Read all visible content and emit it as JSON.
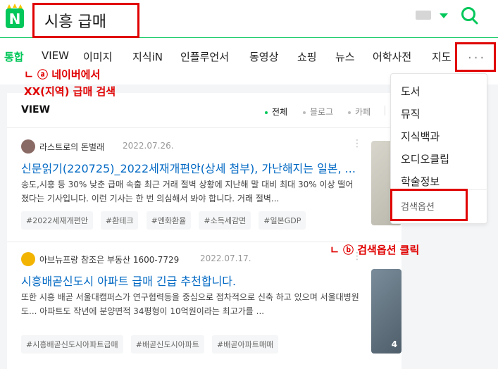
{
  "search": {
    "query": "시흥 급매"
  },
  "header": {
    "logo_letter": "N"
  },
  "tabs": [
    "통합",
    "VIEW",
    "이미지",
    "지식iN",
    "인플루언서",
    "동영상",
    "쇼핑",
    "뉴스",
    "어학사전",
    "지도"
  ],
  "more_label": "···",
  "annotations": {
    "a_line1": "ㄴ ⓐ 네이버에서",
    "a_line2": "XX(지역) 급매 검색",
    "b": "ㄴ ⓑ 검색옵션 클릭"
  },
  "view": {
    "title": "VIEW",
    "filters": [
      "전체",
      "블로그",
      "카페"
    ]
  },
  "posts": [
    {
      "author": "라스트로의 돈벌래",
      "date": "2022.07.26.",
      "title": "신문읽기(220725)_2022세재개편안(상세 첨부), 가난해지는 일본, ...",
      "desc": "송도,시흥 등 30% 낮춘 급매 속출 최근 거래 절벽 상황에 지난해 말 대비 최대 30% 이상 떨어졌다는 기사입니다. 이런 기사는 한 번 의심해서 봐야 합니다. 거래 절벽...",
      "tags": [
        "#2022세재개편안",
        "#환테크",
        "#엔화환율",
        "#소득세감면",
        "#일본GDP"
      ]
    },
    {
      "author": "아브뉴프랑 참조은 부동산 1600-7729",
      "date": "2022.07.17.",
      "title": "시흥배곧신도시 아파트 급매 긴급 추천합니다.",
      "desc": "또한 시흥 배곧 서울대캠퍼스가 연구협력동을 중심으로 점차적으로 신축 하고 있으며 서울대병원도... 아파트도 작년에 분양면적 34평형이 10억원이라는 최고가를 ...",
      "tags": [
        "#시흥배곧신도시아파트급매",
        "#배곧신도시아파트",
        "#배곧아파트매매"
      ],
      "thumb_count": "4"
    }
  ],
  "dropdown": {
    "items": [
      "도서",
      "뮤직",
      "지식백과",
      "오디오클립",
      "학술정보"
    ],
    "options_label": "검색옵션"
  }
}
